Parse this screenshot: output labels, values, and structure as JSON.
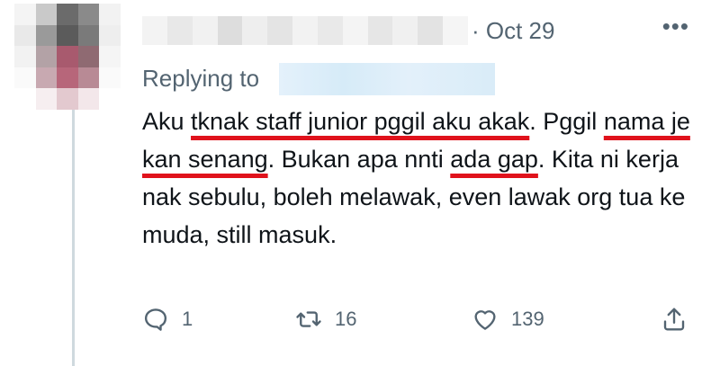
{
  "tweet": {
    "timestamp": "· Oct 29",
    "more_icon": "more-horizontal-icon",
    "replying_label": "Replying to",
    "text_parts": [
      "Aku ",
      "tknak staff junior pggil aku akak",
      ". Pggil ",
      "nama je kan senang",
      ". Bukan apa nnti ",
      "ada gap",
      ". Kita ni kerja nak sebulu, boleh melawak, even lawak org tua ke muda, still masuk."
    ],
    "highlight_color": "#e0121c"
  },
  "actions": {
    "reply": {
      "icon": "reply-icon",
      "count": "1"
    },
    "retweet": {
      "icon": "retweet-icon",
      "count": "16"
    },
    "like": {
      "icon": "heart-icon",
      "count": "139"
    },
    "share": {
      "icon": "share-icon"
    }
  },
  "colors": {
    "text": "#0f1419",
    "secondary": "#536471",
    "thread_line": "#cfd9de"
  }
}
